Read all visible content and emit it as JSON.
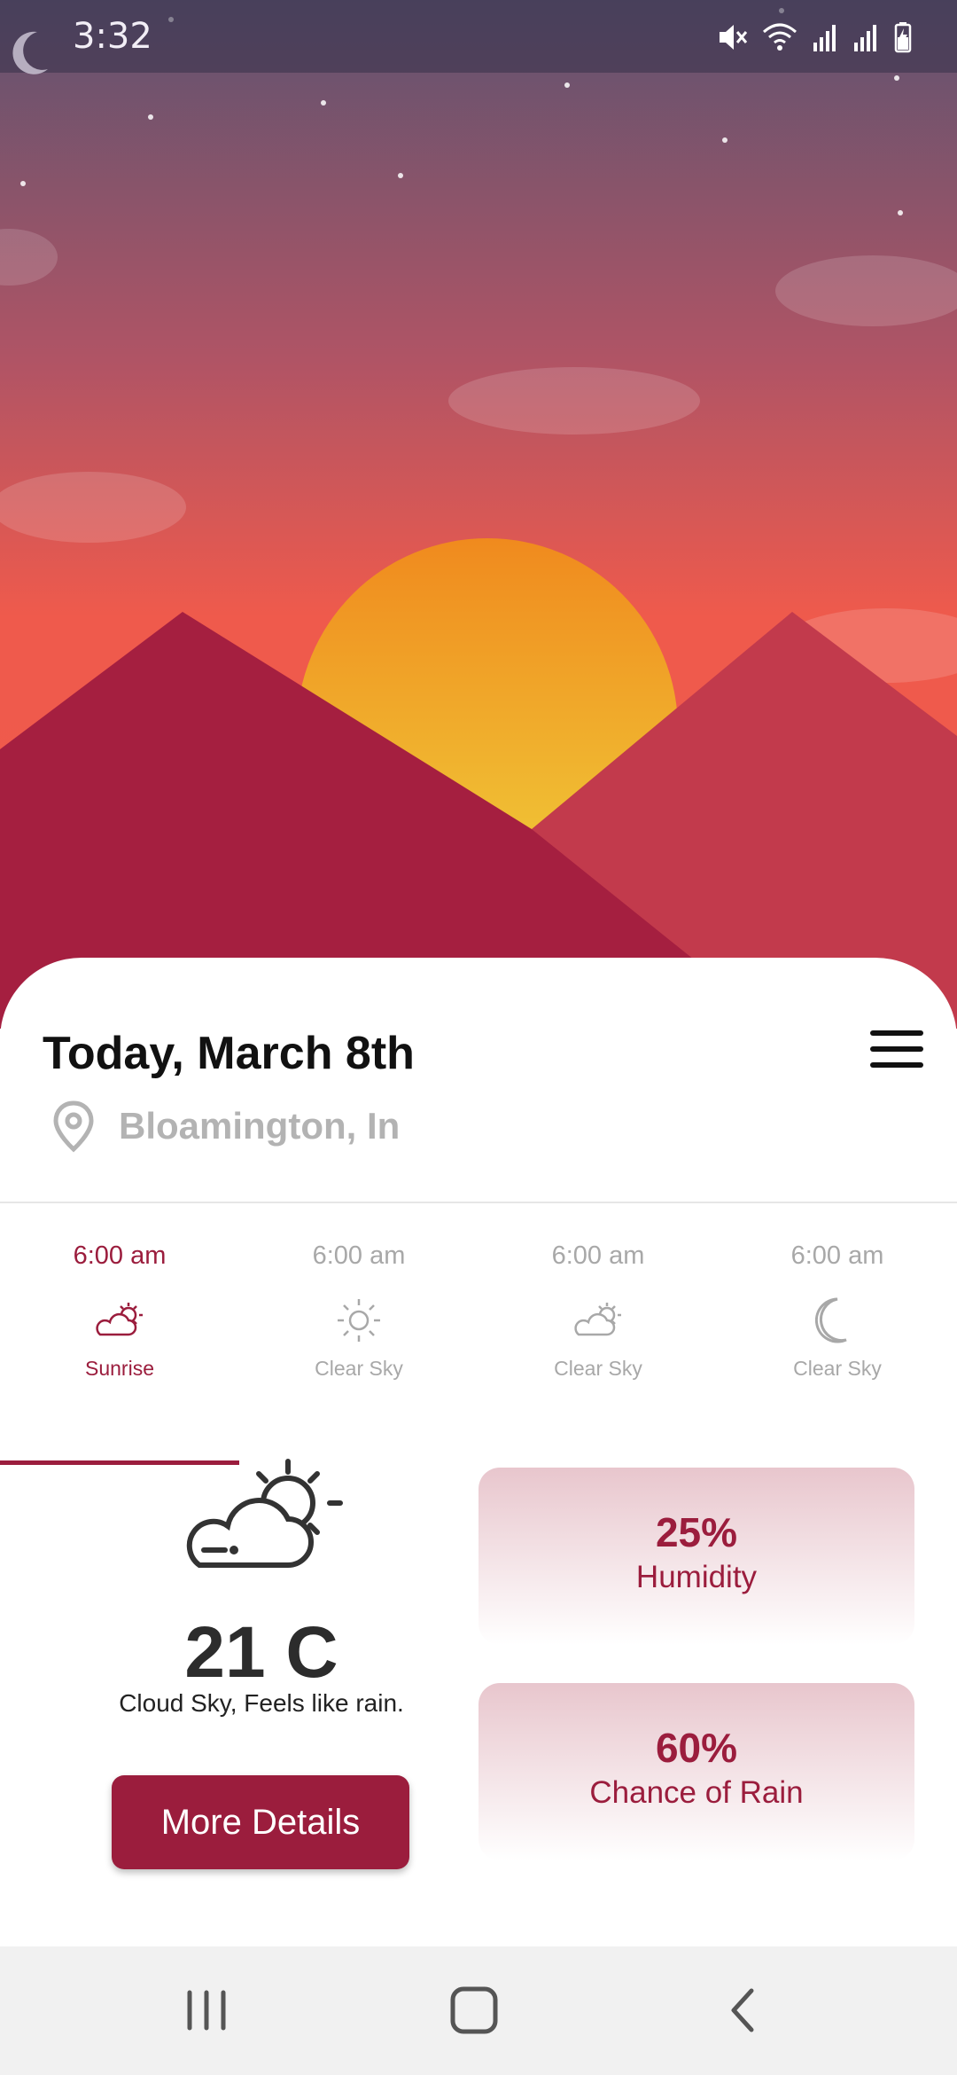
{
  "status_bar": {
    "time": "3:32",
    "icons": [
      "moon-icon",
      "mute-icon",
      "wifi-icon",
      "signal-icon",
      "signal-icon",
      "battery-charging-icon"
    ]
  },
  "header": {
    "date_title": "Today, March 8th",
    "location": "Bloamington, In",
    "menu_icon": "hamburger-menu-icon"
  },
  "tabs": [
    {
      "time": "6:00 am",
      "label": "Sunrise",
      "icon": "cloud-sun-icon",
      "active": true
    },
    {
      "time": "6:00 am",
      "label": "Clear Sky",
      "icon": "sun-icon",
      "active": false
    },
    {
      "time": "6:00 am",
      "label": "Clear Sky",
      "icon": "cloud-sun-icon",
      "active": false
    },
    {
      "time": "6:00 am",
      "label": "Clear Sky",
      "icon": "moon-icon",
      "active": false
    }
  ],
  "current": {
    "icon": "cloud-sun-icon",
    "temperature": "21 C",
    "description": "Cloud Sky, Feels like rain.",
    "details_button": "More Details"
  },
  "stats": [
    {
      "value": "25%",
      "label": "Humidity"
    },
    {
      "value": "60%",
      "label": "Chance of Rain"
    }
  ],
  "colors": {
    "accent": "#9b1d3d",
    "sky_top": "#5e5370",
    "sky_bottom": "#ef5a4c",
    "sun": "#f2b431",
    "mountain_left": "#a51f40",
    "mountain_right": "#c23a4c"
  }
}
